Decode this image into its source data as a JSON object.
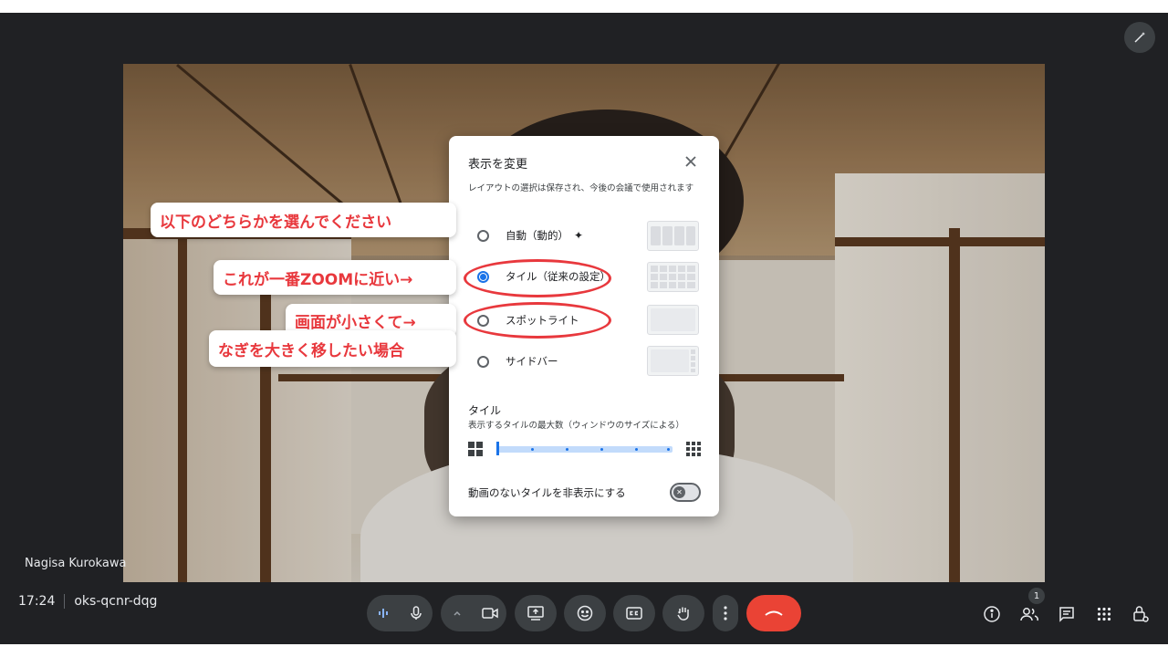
{
  "participant_name": "Nagisa Kurokawa",
  "meeting": {
    "time": "17:24",
    "code": "oks-qcnr-dqg"
  },
  "participants_badge": "1",
  "dialog": {
    "title": "表示を変更",
    "description": "レイアウトの選択は保存され、今後の会議で使用されます",
    "options": [
      {
        "label": "自動（動的）",
        "selected": false
      },
      {
        "label": "タイル（従来の設定）",
        "selected": true
      },
      {
        "label": "スポットライト",
        "selected": false
      },
      {
        "label": "サイドバー",
        "selected": false
      }
    ],
    "tiles_section_title": "タイル",
    "tiles_section_sub": "表示するタイルの最大数（ウィンドウのサイズによる）",
    "tiles_slider_value": 0,
    "hide_no_video_label": "動画のないタイルを非表示にする",
    "hide_no_video_on": false
  },
  "annotations": {
    "choose": "以下のどちらかを選んでください",
    "zoom_like": "これが一番ZOOMに近い→",
    "small_screen_line1": "画面が小さくて→",
    "small_screen_line2": "なぎを大きく移したい場合"
  },
  "colors": {
    "accent": "#1a73e8",
    "end_call": "#ea4335",
    "annotation": "#e8383d"
  }
}
